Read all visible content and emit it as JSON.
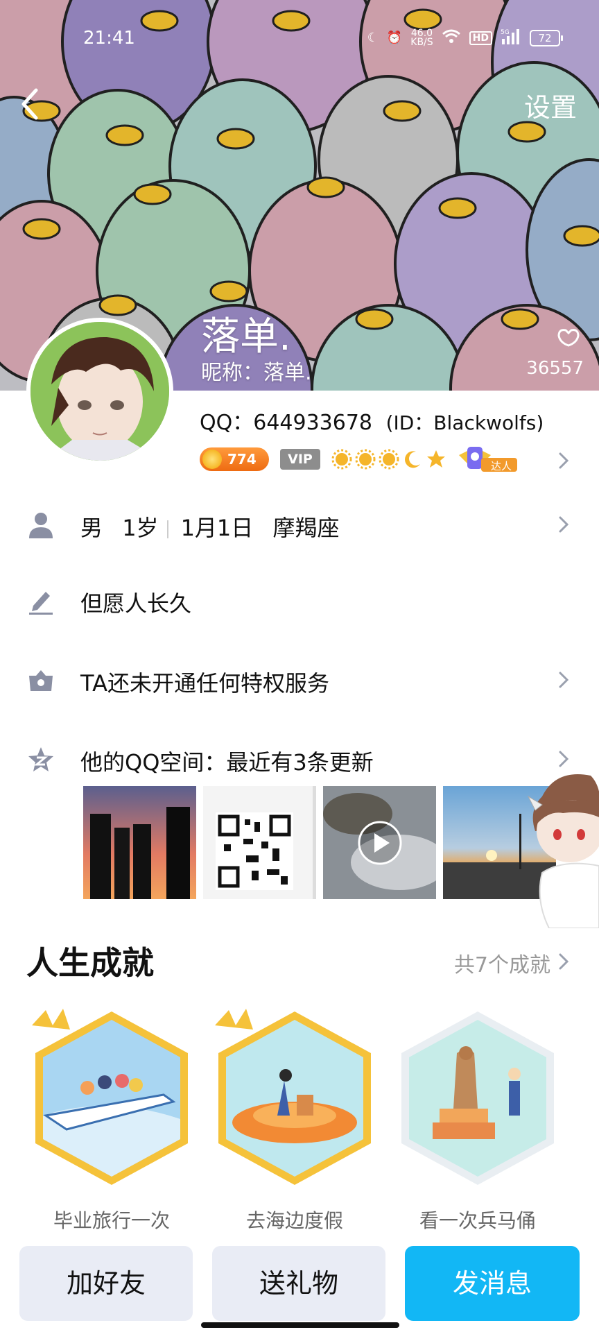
{
  "status_bar": {
    "time": "21:41",
    "net_speed_value": "46.0",
    "net_speed_unit": "KB/S",
    "hd": "HD",
    "signal": "5G",
    "battery": "72"
  },
  "header": {
    "settings_label": "设置",
    "nickname": "落单.",
    "remark": "昵称：落单.",
    "like_count": "36557"
  },
  "identity": {
    "qq_number": "QQ：644933678",
    "id_text": "(ID：Blackwolfs)",
    "coin_level": "774",
    "vip_label": "VIP",
    "daren_label": "达人"
  },
  "info_rows": {
    "gender": "男",
    "age": "1岁",
    "birthday": "1月1日",
    "zodiac": "摩羯座",
    "signature": "但愿人长久",
    "privilege": "TA还未开通任何特权服务",
    "qzone": "他的QQ空间：最近有3条更新"
  },
  "achievements": {
    "title": "人生成就",
    "total": "共7个成就",
    "items": [
      {
        "label": "毕业旅行一次"
      },
      {
        "label": "去海边度假"
      },
      {
        "label": "看一次兵马俑"
      }
    ]
  },
  "bottom_bar": {
    "add_friend": "加好友",
    "send_gift": "送礼物",
    "send_message": "发消息"
  },
  "colors": {
    "accent": "#12b7f5",
    "button_bg": "#e9ecf5",
    "icon_gray": "#8a8fa3",
    "gold": "#f5c23a"
  }
}
